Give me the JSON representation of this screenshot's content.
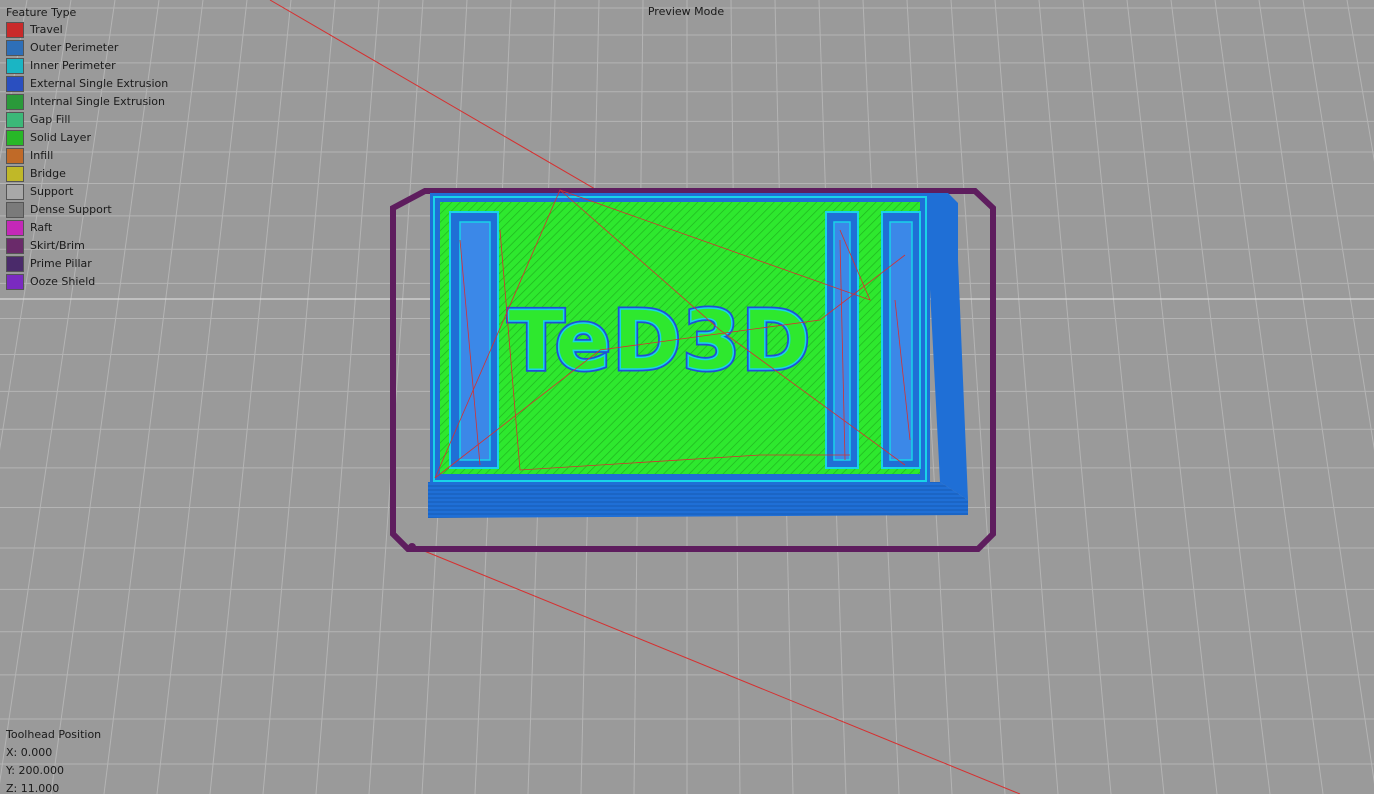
{
  "legend": {
    "title": "Feature Type",
    "items": [
      {
        "label": "Travel",
        "color": "#c92a2a"
      },
      {
        "label": "Outer Perimeter",
        "color": "#2e6fb8"
      },
      {
        "label": "Inner Perimeter",
        "color": "#1ab5c4"
      },
      {
        "label": "External Single Extrusion",
        "color": "#2a4fc0"
      },
      {
        "label": "Internal Single Extrusion",
        "color": "#2a9a3a"
      },
      {
        "label": "Gap Fill",
        "color": "#3cb878"
      },
      {
        "label": "Solid Layer",
        "color": "#28b828"
      },
      {
        "label": "Infill",
        "color": "#c06a28"
      },
      {
        "label": "Bridge",
        "color": "#c0b828"
      },
      {
        "label": "Support",
        "color": "#a8a8a8"
      },
      {
        "label": "Dense Support",
        "color": "#7a7a7a"
      },
      {
        "label": "Raft",
        "color": "#c428b8"
      },
      {
        "label": "Skirt/Brim",
        "color": "#6a2a6a"
      },
      {
        "label": "Prime Pillar",
        "color": "#4a2a6a"
      },
      {
        "label": "Ooze Shield",
        "color": "#7a2ac0"
      }
    ]
  },
  "mode_label": "Preview Mode",
  "toolhead": {
    "title": "Toolhead Position",
    "x": "X: 0.000",
    "y": "Y: 200.000",
    "z": "Z: 11.000"
  },
  "model_text": "TeD3D",
  "colors": {
    "background": "#9a9a9a",
    "grid": "#b4b4b4",
    "skirt": "#5e1d5e",
    "outer_perimeter": "#1f6fd6",
    "inner_perimeter": "#19d3e8",
    "solid_layer": "#2ee82e",
    "travel": "#d63030"
  }
}
